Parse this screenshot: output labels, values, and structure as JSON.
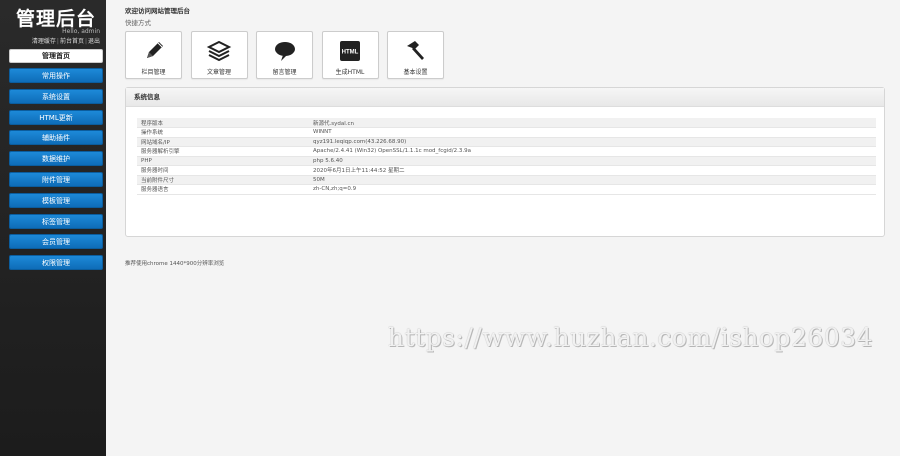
{
  "brand": {
    "title": "管理后台",
    "hello": "Hello, admin"
  },
  "top_links": [
    "清理缓存",
    "前台首页",
    "退出"
  ],
  "menu_home": "管理首页",
  "menu": [
    "常用操作",
    "系统设置",
    "HTML更新",
    "辅助插件",
    "数据维护",
    "附件管理",
    "模板管理",
    "标签管理",
    "会员管理",
    "权限管理"
  ],
  "welcome": "欢迎访问网站管理后台",
  "quick_title": "快捷方式",
  "tiles": [
    {
      "label": "栏目管理",
      "icon": "pencil-icon"
    },
    {
      "label": "文章管理",
      "icon": "stack-icon"
    },
    {
      "label": "留言管理",
      "icon": "comment-icon"
    },
    {
      "label": "生成HTML",
      "icon": "html-icon",
      "badge": "HTML"
    },
    {
      "label": "基本设置",
      "icon": "hammer-icon"
    }
  ],
  "panel_title": "系统信息",
  "info": [
    {
      "k": "程序版本",
      "v": "新源代.sydal.cn"
    },
    {
      "k": "操作系统",
      "v": "WINNT"
    },
    {
      "k": "网站域名/IP",
      "v": "qyz191.leqiqp.com(43.226.68.90)"
    },
    {
      "k": "服务器解析引擎",
      "v": "Apache/2.4.41 (Win32) OpenSSL/1.1.1c mod_fcgid/2.3.9a"
    },
    {
      "k": "PHP",
      "v": "php 5.6.40"
    },
    {
      "k": "服务器时间",
      "v": "2020年6月1日上午11:44:52 星期二"
    },
    {
      "k": "当前附件尺寸",
      "v": "50M"
    },
    {
      "k": "服务器语言",
      "v": "zh-CN,zh;q=0.9"
    }
  ],
  "footer": "推荐使用chrome 1440*900分辨率浏览",
  "watermark": "https://www.huzhan.com/ishop26034",
  "colors": {
    "sidebar": "#222222",
    "menu_blue": "#1580cc",
    "background": "#f4f4f4"
  }
}
